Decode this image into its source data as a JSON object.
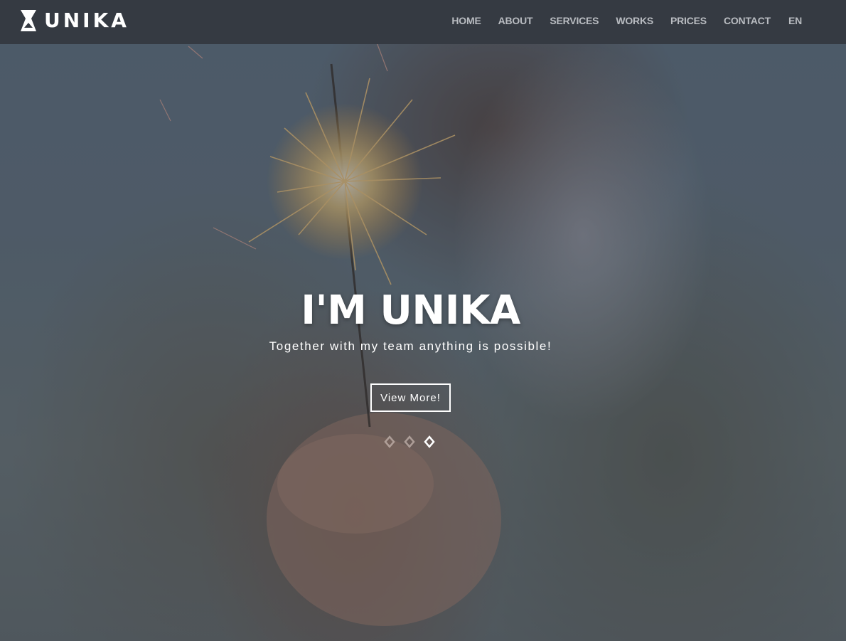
{
  "header": {
    "logo_text": "UNIKA",
    "logo_icon": "hourglass-icon",
    "nav": [
      {
        "label": "HOME"
      },
      {
        "label": "ABOUT"
      },
      {
        "label": "SERVICES"
      },
      {
        "label": "WORKS"
      },
      {
        "label": "PRICES"
      },
      {
        "label": "CONTACT"
      },
      {
        "label": "EN"
      }
    ]
  },
  "hero": {
    "title": "I'M UNIKA",
    "subtitle": "Together with my team anything is possible!",
    "button_label": "View More!",
    "slides": [
      {
        "active": false
      },
      {
        "active": false
      },
      {
        "active": true
      }
    ]
  },
  "colors": {
    "header_bg": "#353a42",
    "nav_text": "#b9bcc1",
    "hero_text": "#ffffff"
  }
}
